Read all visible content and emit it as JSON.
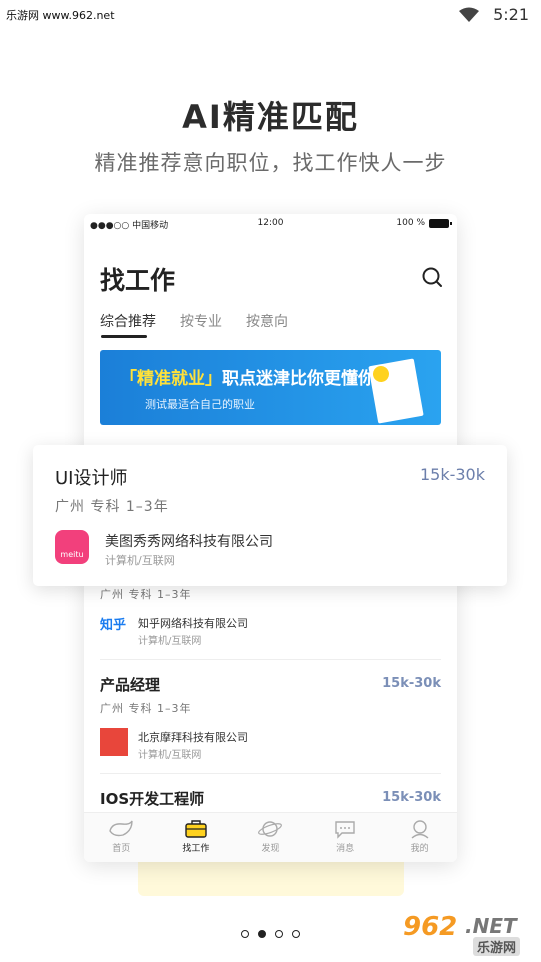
{
  "statusbar": {
    "watermark": "乐游网 www.962.net",
    "time": "5:21"
  },
  "hero": {
    "title": "AI精准匹配",
    "subtitle": "精准推荐意向职位，找工作快人一步"
  },
  "phone": {
    "status": {
      "carrier": "●●●○○ 中国移动",
      "time": "12:00",
      "battery": "100 %"
    },
    "title": "找工作",
    "tabs": [
      "综合推荐",
      "按专业",
      "按意向"
    ],
    "banner": {
      "title_highlight": "「精准就业」",
      "title_rest": "职点迷津比你更懂你",
      "subtitle": "测试最适合自己的职业"
    },
    "jobs": [
      {
        "meta": "广州  专科  1–3年",
        "company": "知乎网络科技有限公司",
        "category": "计算机/互联网",
        "logo": "知乎"
      },
      {
        "title": "产品经理",
        "salary": "15k-30k",
        "meta": "广州  专科  1–3年",
        "company": "北京摩拜科技有限公司",
        "category": "计算机/互联网"
      },
      {
        "title": "IOS开发工程师",
        "salary": "15k-30k"
      }
    ],
    "tabbar": [
      "首页",
      "找工作",
      "发现",
      "消息",
      "我的"
    ]
  },
  "card": {
    "title": "UI设计师",
    "salary": "15k-30k",
    "meta": "广州  专科  1–3年",
    "company": "美图秀秀网络科技有限公司",
    "category": "计算机/互联网",
    "logo_text": "meitu"
  },
  "watermark": {
    "big": "962",
    "net": ".NET",
    "cn": "乐游网"
  },
  "colors": {
    "salary": "#7b8fb7",
    "banner": "#1b7fd8",
    "accent_yellow": "#ffd21f"
  }
}
